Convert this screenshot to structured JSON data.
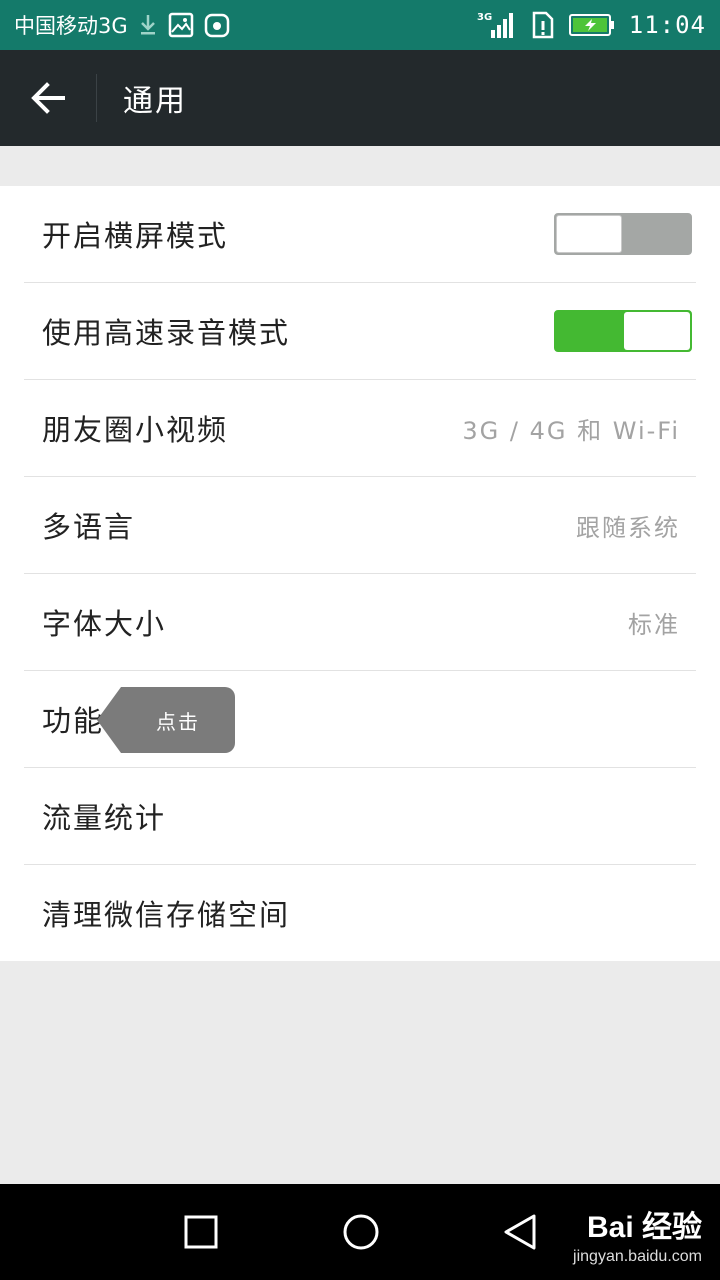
{
  "status_bar": {
    "carrier": "中国移动3G",
    "network_badge": "3G",
    "time": "11:04",
    "icons": [
      "download-icon",
      "gallery-icon",
      "huawei-app-icon",
      "signal-icon",
      "sim-alert-icon",
      "battery-charging-icon"
    ]
  },
  "app_bar": {
    "title": "通用",
    "back_icon": "back-arrow-icon"
  },
  "settings": {
    "rows": [
      {
        "label": "开启横屏模式",
        "type": "toggle",
        "on": false
      },
      {
        "label": "使用高速录音模式",
        "type": "toggle",
        "on": true
      },
      {
        "label": "朋友圈小视频",
        "type": "value",
        "value": "3G / 4G 和 Wi-Fi"
      },
      {
        "label": "多语言",
        "type": "value",
        "value": "跟随系统"
      },
      {
        "label": "字体大小",
        "type": "value",
        "value": "标准"
      },
      {
        "label": "功能",
        "type": "link",
        "tooltip": "点击"
      },
      {
        "label": "流量统计",
        "type": "link"
      },
      {
        "label": "清理微信存储空间",
        "type": "link"
      }
    ]
  },
  "nav_bar": {
    "buttons": [
      "recent-apps-icon",
      "home-icon",
      "back-icon"
    ]
  },
  "watermark": {
    "brand": "Bai 经验",
    "url": "jingyan.baidu.com"
  },
  "colors": {
    "status_bar": "#147a6a",
    "app_bar": "#23292c",
    "toggle_on": "#44b932",
    "toggle_off": "#a4a7a5"
  }
}
